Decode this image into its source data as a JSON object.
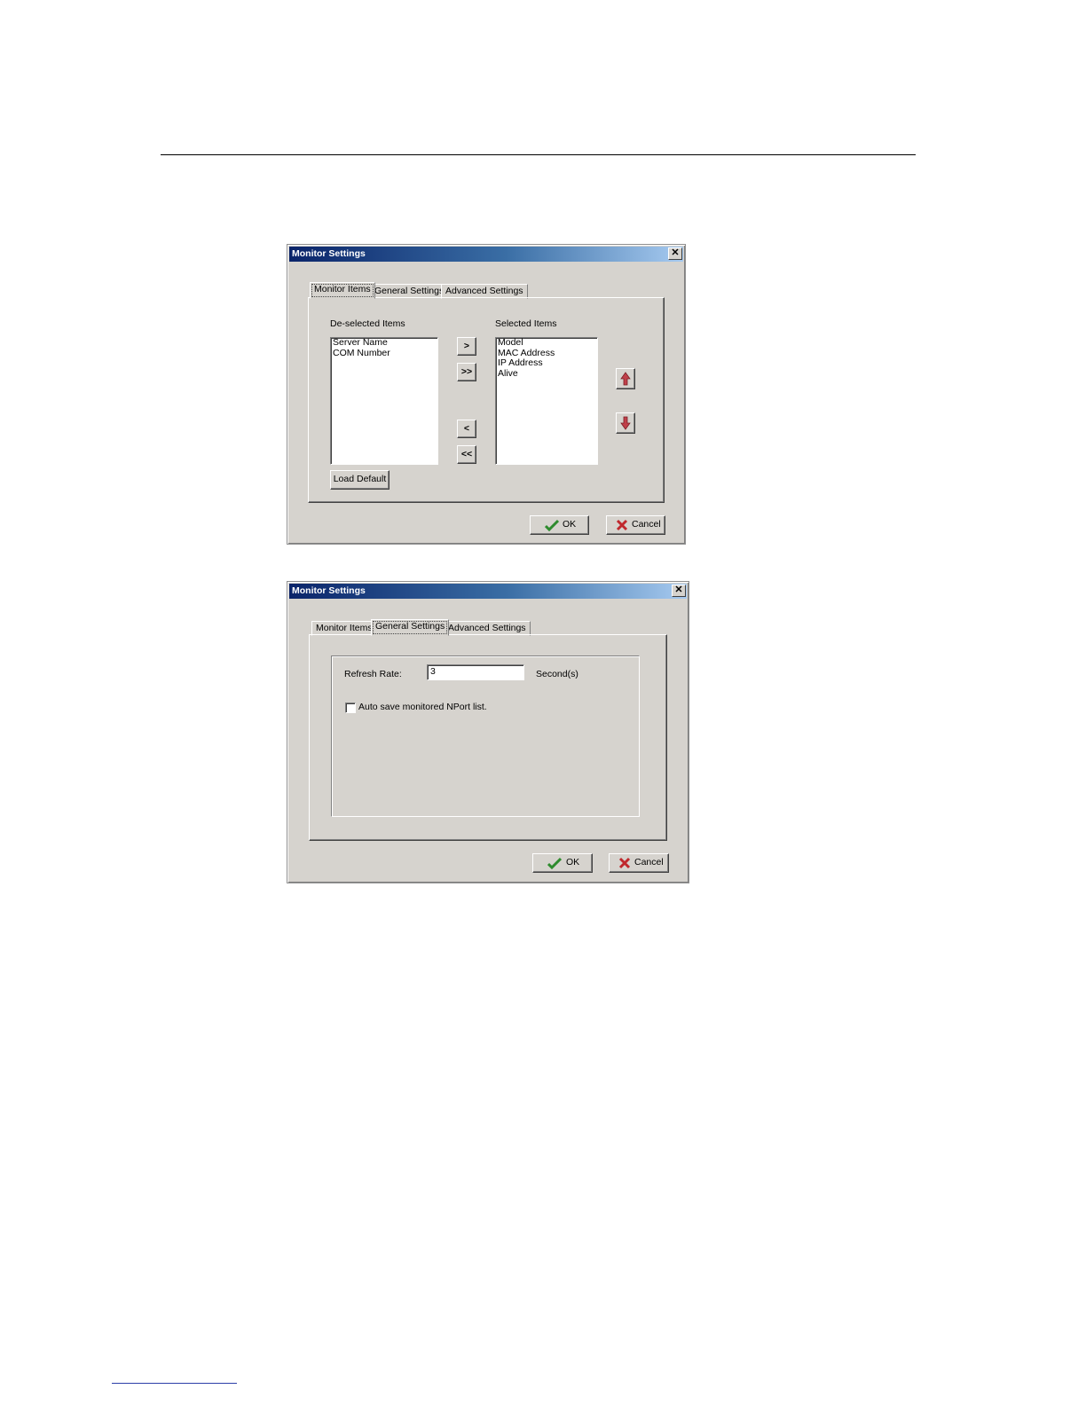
{
  "dialog1": {
    "title": "Monitor Settings",
    "close_glyph": "✕",
    "tabs": [
      "Monitor Items",
      "General Settings",
      "Advanced Settings"
    ],
    "active_tab": "Monitor Items",
    "deselected_label": "De-selected Items",
    "deselected_items": [
      "Server Name",
      "COM Number"
    ],
    "selected_label": "Selected Items",
    "selected_items": [
      "Model",
      "MAC Address",
      "IP Address",
      "Alive"
    ],
    "move_right": ">",
    "move_all_right": ">>",
    "move_left": "<",
    "move_all_left": "<<",
    "load_default": "Load Default",
    "ok": "OK",
    "cancel": "Cancel"
  },
  "dialog2": {
    "title": "Monitor Settings",
    "close_glyph": "✕",
    "tabs": [
      "Monitor Items",
      "General Settings",
      "Advanced Settings"
    ],
    "active_tab": "General Settings",
    "refresh_rate_label": "Refresh Rate:",
    "refresh_rate_value": "3",
    "refresh_rate_unit": "Second(s)",
    "auto_save_label": "Auto save monitored NPort list.",
    "auto_save_checked": false,
    "ok": "OK",
    "cancel": "Cancel"
  },
  "icons": {
    "ok": "checkmark-icon",
    "cancel": "x-mark-icon",
    "up": "arrow-up-icon",
    "down": "arrow-down-icon"
  },
  "colors": {
    "dialog_bg": "#d6d3ce",
    "title_start": "#0a246a",
    "title_end": "#a6caf0",
    "ok_check": "#2e8b2e",
    "cancel_x": "#c0282d",
    "arrow_red": "#c0404a"
  }
}
